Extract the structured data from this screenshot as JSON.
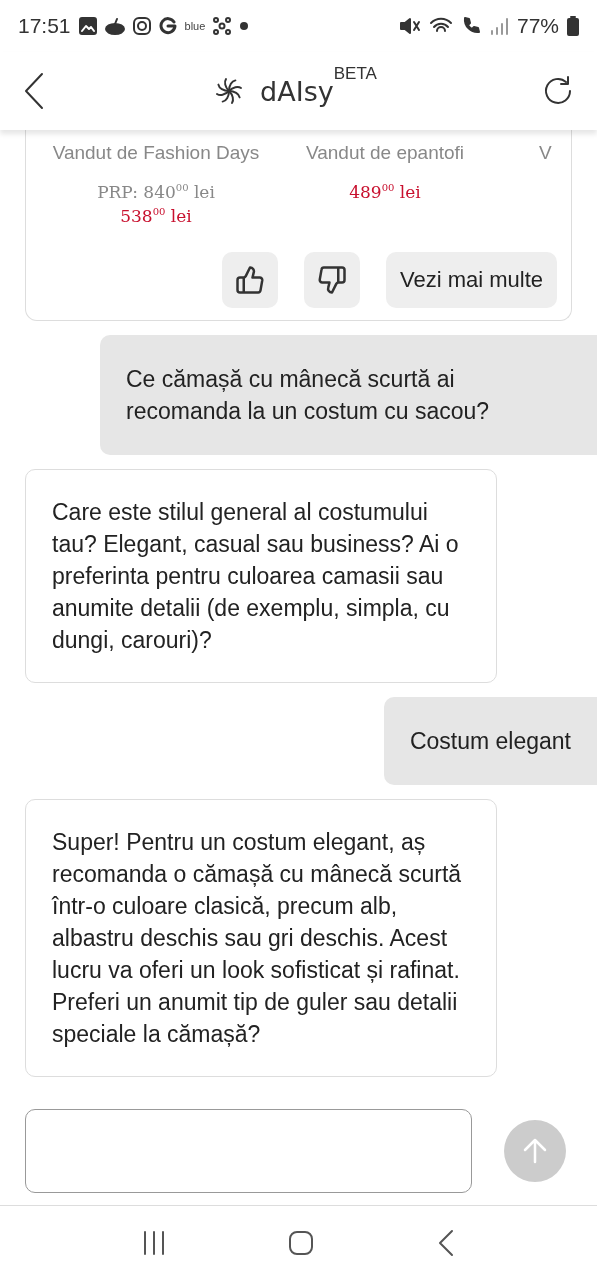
{
  "status_bar": {
    "time": "17:51",
    "carrier_label": "blue",
    "battery": "77%"
  },
  "header": {
    "title": "dAIsy",
    "badge": "BETA"
  },
  "products": [
    {
      "seller": "Vandut de Fashion Days",
      "old_price": "PRP: 840$^{00}$ lei",
      "price": "538$^{00}$ lei"
    },
    {
      "seller": "Vandut de epantofi",
      "price": "489$^{00}$ lei"
    },
    {
      "seller": "V"
    }
  ],
  "product_actions": {
    "more_button": "Vezi mai multe"
  },
  "messages": [
    {
      "kind": "user",
      "text": "Ce cămașă cu mânecă scurtă ai recomanda la un costum cu sacou?"
    },
    {
      "kind": "bot",
      "text": "Care este stilul general al costumului tau? Elegant, casual sau business? Ai o preferinta pentru culoarea camasii sau anumite detalii (de exemplu, simpla, cu dungi, carouri)?"
    },
    {
      "kind": "user",
      "text": "Costum elegant"
    },
    {
      "kind": "bot",
      "text": "Super! Pentru un costum elegant, aș recomanda o cămașă cu mânecă scurtă într-o culoare clasică, precum alb, albastru deschis sau gri deschis. Acest lucru va oferi un look sofisticat și rafinat. Preferi un anumit tip de guler sau detalii speciale la cămașă?"
    }
  ],
  "composer": {
    "send_disabled": true
  }
}
